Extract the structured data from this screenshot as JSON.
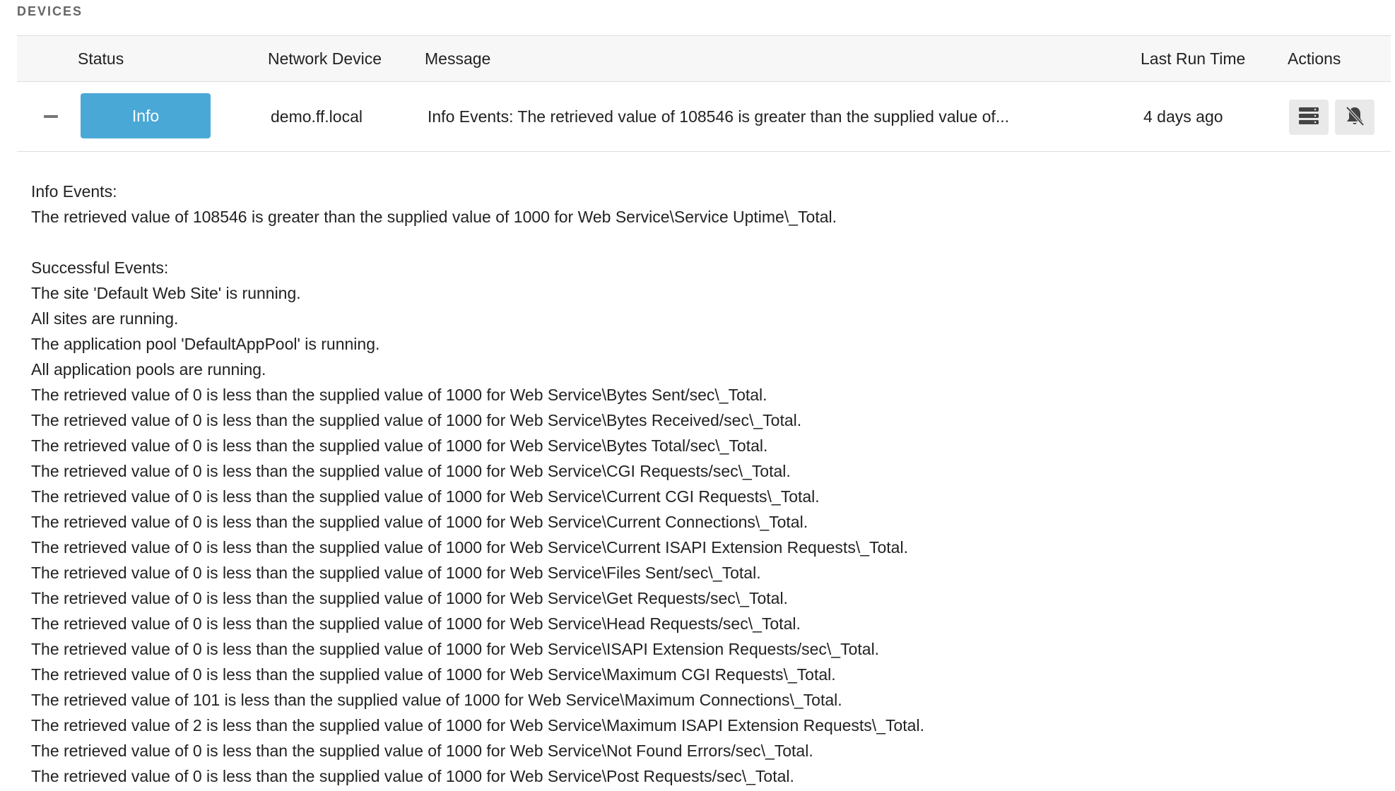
{
  "section": {
    "title": "DEVICES"
  },
  "table": {
    "headers": {
      "status": "Status",
      "network_device": "Network Device",
      "message": "Message",
      "last_run_time": "Last Run Time",
      "actions": "Actions"
    },
    "row": {
      "status": "Info",
      "status_color": "#4aa8d6",
      "network_device": "demo.ff.local",
      "message": "Info Events: The retrieved value of 108546 is greater than the supplied value of...",
      "last_run_time": "4 days ago",
      "action_icons": [
        "server-list-icon",
        "bell-slash-icon"
      ]
    }
  },
  "details": {
    "lines": [
      "Info Events:",
      "The retrieved value of 108546 is greater than the supplied value of 1000 for Web Service\\Service Uptime\\_Total.",
      "",
      "Successful Events:",
      "The site 'Default Web Site' is running.",
      "All sites are running.",
      "The application pool 'DefaultAppPool' is running.",
      "All application pools are running.",
      "The retrieved value of 0 is less than the supplied value of 1000 for Web Service\\Bytes Sent/sec\\_Total.",
      "The retrieved value of 0 is less than the supplied value of 1000 for Web Service\\Bytes Received/sec\\_Total.",
      "The retrieved value of 0 is less than the supplied value of 1000 for Web Service\\Bytes Total/sec\\_Total.",
      "The retrieved value of 0 is less than the supplied value of 1000 for Web Service\\CGI Requests/sec\\_Total.",
      "The retrieved value of 0 is less than the supplied value of 1000 for Web Service\\Current CGI Requests\\_Total.",
      "The retrieved value of 0 is less than the supplied value of 1000 for Web Service\\Current Connections\\_Total.",
      "The retrieved value of 0 is less than the supplied value of 1000 for Web Service\\Current ISAPI Extension Requests\\_Total.",
      "The retrieved value of 0 is less than the supplied value of 1000 for Web Service\\Files Sent/sec\\_Total.",
      "The retrieved value of 0 is less than the supplied value of 1000 for Web Service\\Get Requests/sec\\_Total.",
      "The retrieved value of 0 is less than the supplied value of 1000 for Web Service\\Head Requests/sec\\_Total.",
      "The retrieved value of 0 is less than the supplied value of 1000 for Web Service\\ISAPI Extension Requests/sec\\_Total.",
      "The retrieved value of 0 is less than the supplied value of 1000 for Web Service\\Maximum CGI Requests\\_Total.",
      "The retrieved value of 101 is less than the supplied value of 1000 for Web Service\\Maximum Connections\\_Total.",
      "The retrieved value of 2 is less than the supplied value of 1000 for Web Service\\Maximum ISAPI Extension Requests\\_Total.",
      "The retrieved value of 0 is less than the supplied value of 1000 for Web Service\\Not Found Errors/sec\\_Total.",
      "The retrieved value of 0 is less than the supplied value of 1000 for Web Service\\Post Requests/sec\\_Total."
    ]
  }
}
